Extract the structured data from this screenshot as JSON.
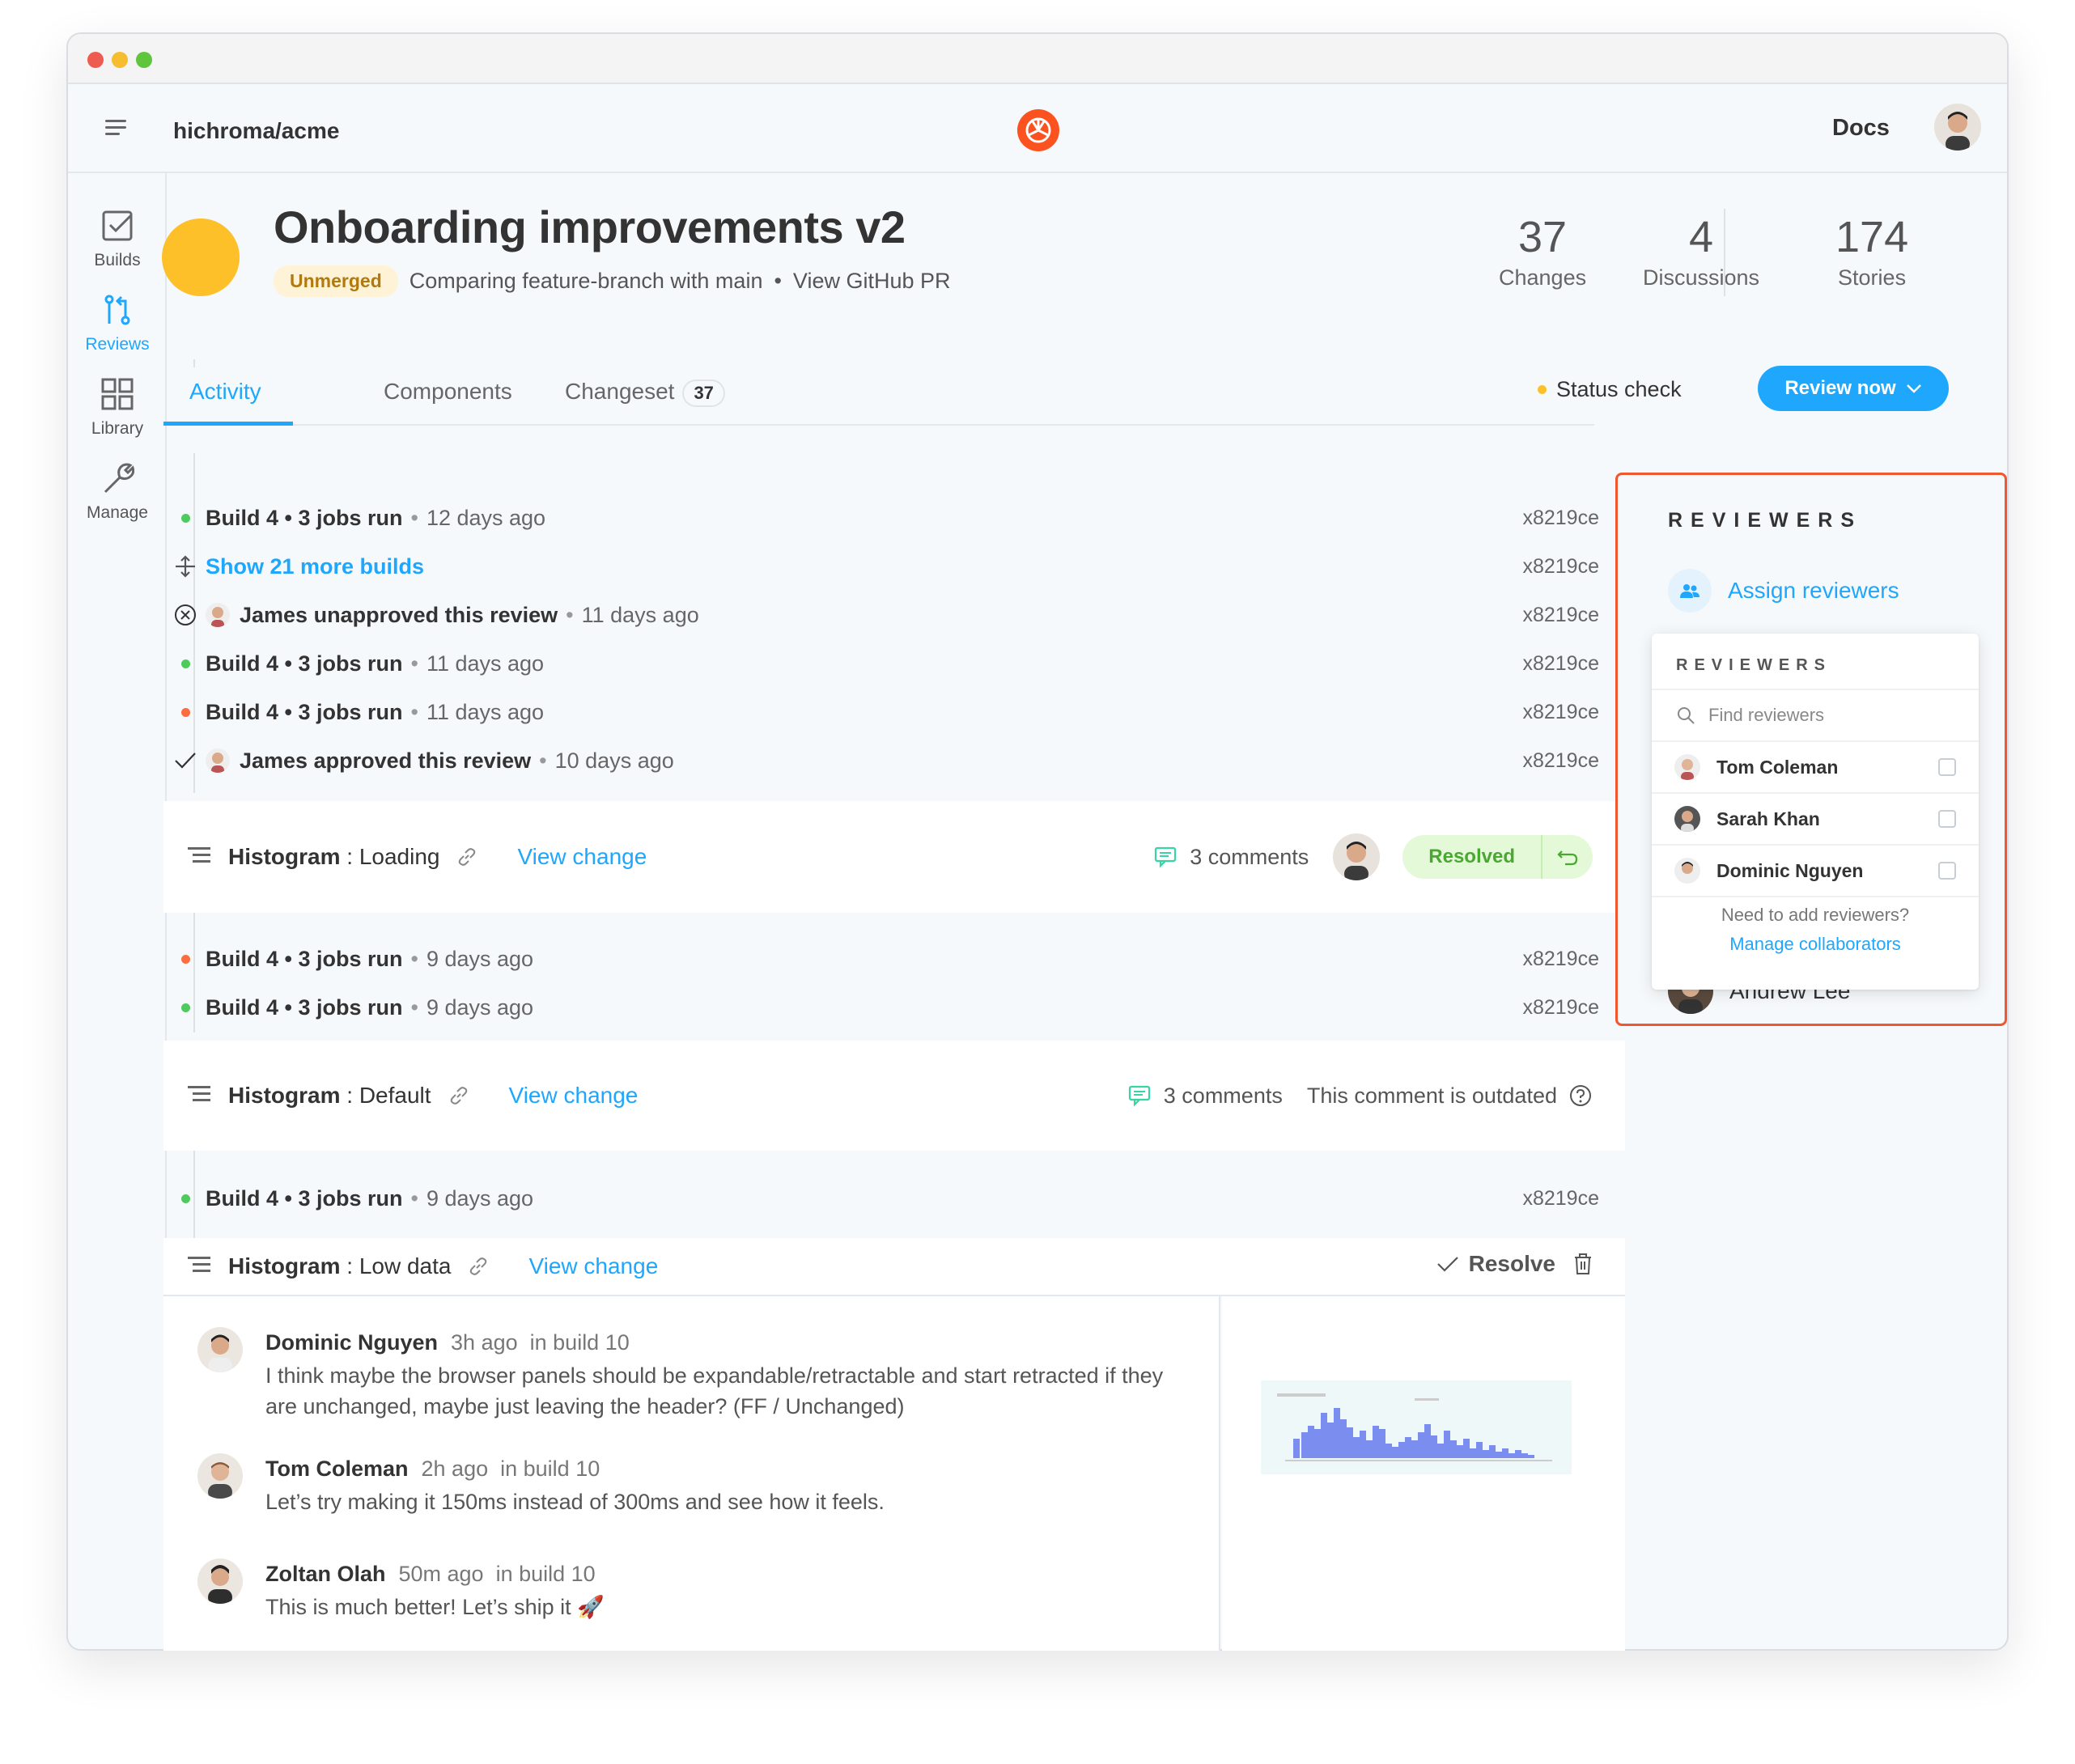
{
  "window": {
    "title": ""
  },
  "appbar": {
    "repo": "hichroma/acme",
    "docs": "Docs"
  },
  "sidebar": {
    "items": [
      {
        "label": "Builds",
        "icon": "checkbox-icon",
        "active": false
      },
      {
        "label": "Reviews",
        "icon": "pull-request-icon",
        "active": true
      },
      {
        "label": "Library",
        "icon": "grid-icon",
        "active": false
      },
      {
        "label": "Manage",
        "icon": "wrench-icon",
        "active": false
      }
    ]
  },
  "pr": {
    "title": "Onboarding improvements v2",
    "status": "Unmerged",
    "comparing": "Comparing feature-branch with main",
    "bullet": "•",
    "github_link": "View GitHub PR"
  },
  "stats": [
    {
      "value": "37",
      "label": "Changes"
    },
    {
      "value": "4",
      "label": "Discussions"
    },
    {
      "value": "174",
      "label": "Stories"
    }
  ],
  "tabs": [
    {
      "label": "Activity",
      "active": true
    },
    {
      "label": "Components",
      "active": false
    },
    {
      "label": "Changeset",
      "count": "37",
      "active": false
    }
  ],
  "status_check": "Status check",
  "review_now": "Review now",
  "activity": [
    {
      "type": "build",
      "dot": "green",
      "title": "Build 4 • 3 jobs run",
      "time": "12 days ago",
      "hash": "x8219ce"
    },
    {
      "type": "more",
      "label": "Show 21 more builds",
      "hash": "x8219ce"
    },
    {
      "type": "review",
      "icon": "x-circle-icon",
      "actor": "James unapproved this review",
      "time": "11 days ago",
      "hash": "x8219ce"
    },
    {
      "type": "build",
      "dot": "green",
      "title": "Build 4 • 3 jobs run",
      "time": "11 days ago",
      "hash": "x8219ce"
    },
    {
      "type": "build",
      "dot": "orange",
      "title": "Build 4 • 3 jobs run",
      "time": "11 days ago",
      "hash": "x8219ce"
    },
    {
      "type": "review",
      "icon": "check-icon",
      "actor": "James approved this review",
      "time": "10 days ago",
      "hash": "x8219ce"
    }
  ],
  "card1": {
    "component": "Histogram",
    "story": "Loading",
    "view_change": "View change",
    "comments": "3 comments",
    "resolved": "Resolved"
  },
  "activity2": [
    {
      "dot": "orange",
      "title": "Build 4 • 3 jobs run",
      "time": "9 days ago",
      "hash": "x8219ce"
    },
    {
      "dot": "green",
      "title": "Build 4 • 3 jobs run",
      "time": "9 days ago",
      "hash": "x8219ce"
    }
  ],
  "card2": {
    "component": "Histogram",
    "story": "Default",
    "view_change": "View change",
    "comments": "3 comments",
    "outdated": "This comment is outdated"
  },
  "activity3": [
    {
      "dot": "green",
      "title": "Build 4 • 3 jobs run",
      "time": "9 days ago",
      "hash": "x8219ce"
    }
  ],
  "card3": {
    "component": "Histogram",
    "story": "Low data",
    "view_change": "View change",
    "resolve": "Resolve"
  },
  "thread": [
    {
      "author": "Dominic Nguyen",
      "time": "3h ago",
      "build": "in build 10",
      "text": "I think maybe the browser panels should be expandable/retractable and start retracted if they are unchanged, maybe just leaving the header? (FF / Unchanged)"
    },
    {
      "author": "Tom Coleman",
      "time": "2h ago",
      "build": "in build 10",
      "text": "Let’s try making it 150ms instead of 300ms and see how it feels."
    },
    {
      "author": "Zoltan Olah",
      "time": "50m ago",
      "build": "in build 10",
      "text": "This is much better! Let’s ship it 🚀"
    }
  ],
  "reviewers_panel": {
    "title": "REVIEWERS",
    "assign": "Assign reviewers",
    "behind": "Andrew Lee",
    "dropdown": {
      "title": "REVIEWERS",
      "search_placeholder": "Find reviewers",
      "people": [
        "Tom Coleman",
        "Sarah Khan",
        "Dominic Nguyen"
      ],
      "footer": "Need to add reviewers?",
      "manage": "Manage collaborators"
    }
  },
  "colors": {
    "accent": "#1ea7fd",
    "highlight": "#f0572e",
    "pr_dot": "#fdc029",
    "green": "#4ecb5c",
    "orange": "#fc6d3f"
  }
}
